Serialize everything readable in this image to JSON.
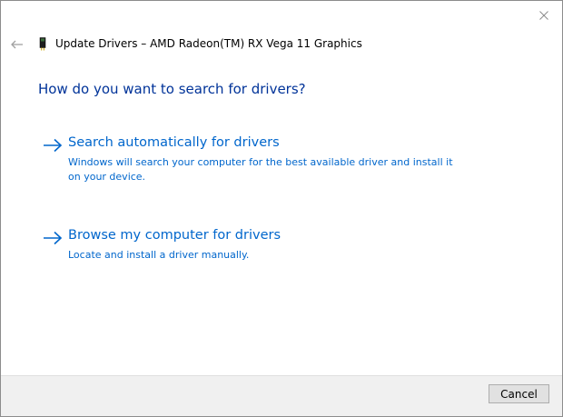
{
  "window": {
    "title": "Update Drivers – AMD Radeon(TM) RX Vega 11 Graphics"
  },
  "main": {
    "heading": "How do you want to search for drivers?",
    "options": [
      {
        "title": "Search automatically for drivers",
        "description": "Windows will search your computer for the best available driver and install it on your device."
      },
      {
        "title": "Browse my computer for drivers",
        "description": "Locate and install a driver manually."
      }
    ]
  },
  "footer": {
    "cancel_label": "Cancel"
  },
  "colors": {
    "heading": "#003399",
    "link": "#0066cc",
    "footer_bg": "#f0f0f0"
  },
  "icons": {
    "close": "close-icon",
    "back": "back-arrow-icon",
    "device": "display-adapter-icon",
    "option_arrow": "right-arrow-icon"
  }
}
